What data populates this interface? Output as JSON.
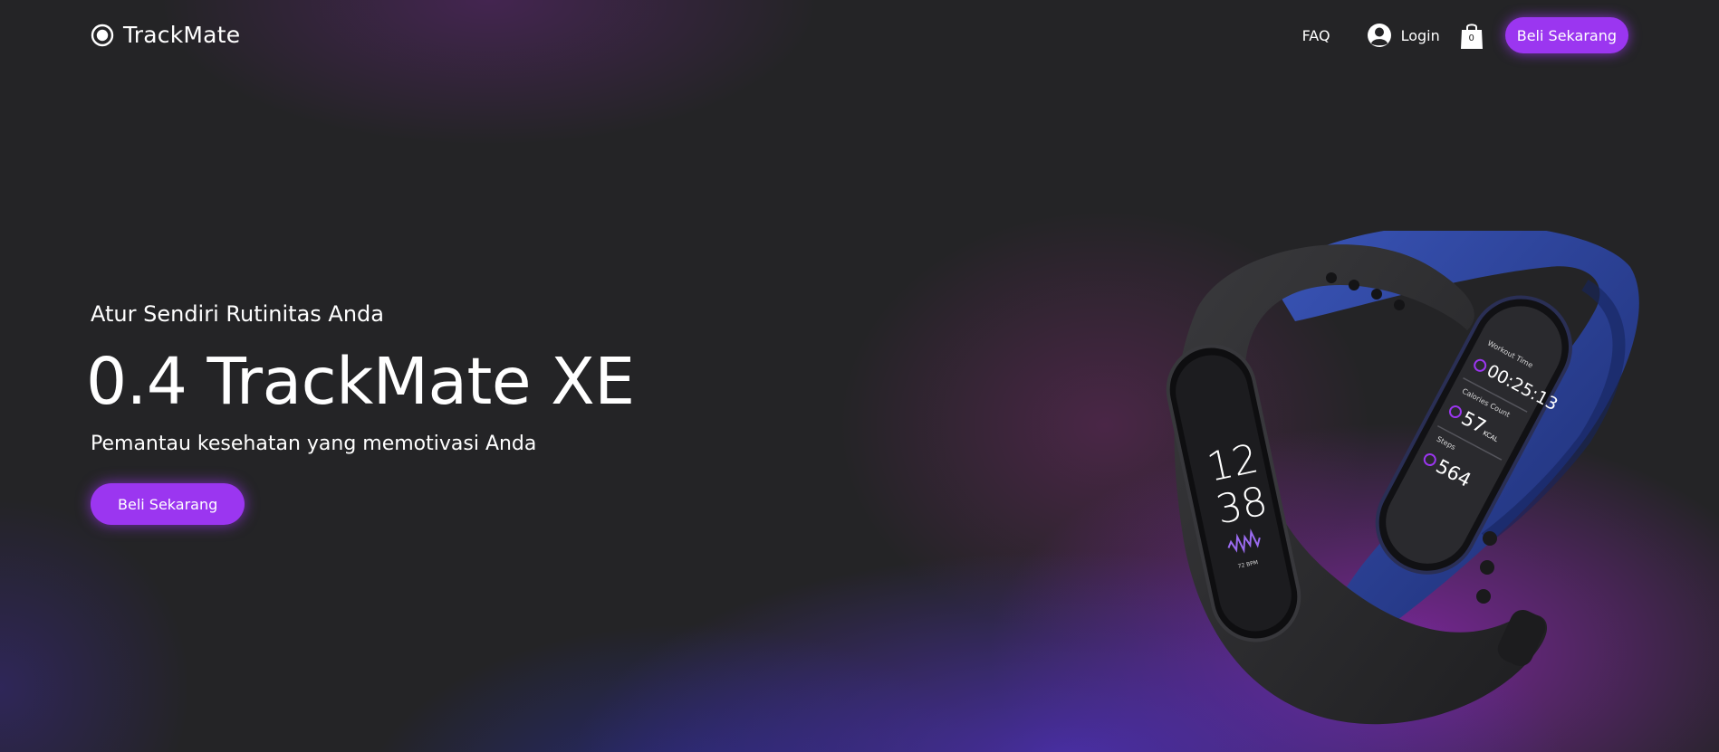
{
  "header": {
    "brand_name": "TrackMate",
    "nav": {
      "faq_label": "FAQ",
      "login_label": "Login",
      "cart_count": "0",
      "cta_label": "Beli Sekarang"
    }
  },
  "hero": {
    "eyebrow": "Atur Sendiri Rutinitas Anda",
    "title": "0.4 TrackMate XE",
    "subtitle": "Pemantau kesehatan yang memotivasi Anda",
    "cta_label": "Beli Sekarang"
  },
  "product_image": {
    "black_band_screen": {
      "time_hour": "12",
      "time_minute": "38",
      "bpm_label": "72 BPM"
    },
    "blue_band_screen": {
      "workout_label": "Workout Time",
      "workout_value": "00:25:13",
      "calories_label": "Calories Count",
      "calories_value": "57",
      "calories_unit": "KCAL",
      "steps_label": "Steps",
      "steps_value": "564"
    }
  },
  "colors": {
    "accent": "#9b36f0",
    "background": "#242426",
    "text": "#ffffff",
    "band_blue": "#2a3f8f",
    "band_black": "#2a2a2c"
  },
  "icons": {
    "brand": "record-circle-icon",
    "login": "user-circle-icon",
    "cart": "shopping-bag-icon"
  }
}
